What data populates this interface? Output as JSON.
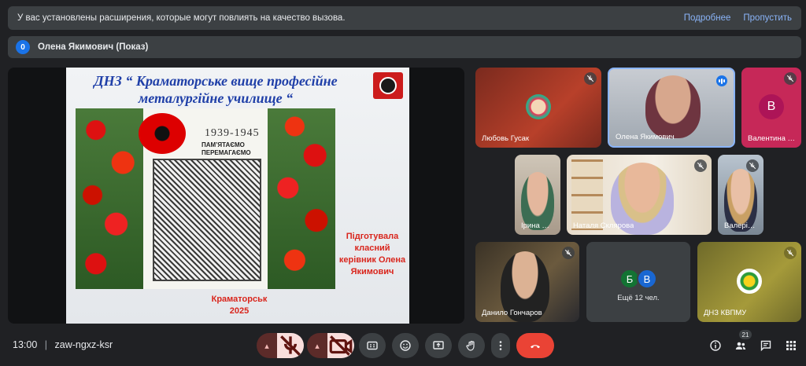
{
  "notice": {
    "message": "У вас установлены расширения, которые могут повлиять на качество вызова.",
    "more_link": "Подробнее",
    "skip_link": "Пропустить"
  },
  "presenter": {
    "badge": "0",
    "label": "Олена Якимович (Показ)"
  },
  "slide": {
    "title_line1": "ДНЗ “  Краматорське вище професійне",
    "title_line2": "металургійне училище “",
    "poster_years": "1939-1945",
    "poster_text_1": "ПАМ’ЯТАЄМО",
    "poster_text_2": "ПЕРЕМАГАЄМО",
    "author_1": "Підготувала",
    "author_2": "класний",
    "author_3": "керівник Олена",
    "author_4": "Якимович",
    "city": "Краматорськ",
    "year": "2025"
  },
  "participants": {
    "p1": "Любовь Гусак",
    "p2": "Олена Якимович",
    "p3": "Валентина Г…",
    "p3_initial": "В",
    "p4": "Ірина Ш…",
    "p5": "Наталя Склярова",
    "p6": "Валерія…",
    "p7": "Данило Гончаров",
    "more_initial_1": "Б",
    "more_initial_2": "В",
    "more_label": "Ещё 12 чел.",
    "p9": "ДНЗ КВПМУ"
  },
  "toolbar": {
    "time": "13:00",
    "separator": "|",
    "meeting_code": "zaw-ngxz-ksr",
    "people_count": "21"
  },
  "colors": {
    "accent": "#1a73e8",
    "danger": "#ea4335",
    "link": "#8ab4f8"
  }
}
